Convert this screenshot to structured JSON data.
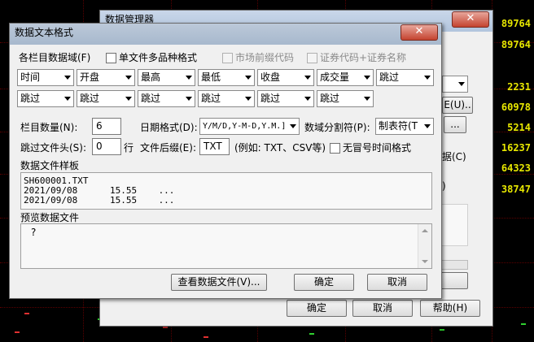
{
  "background": {
    "prices": [
      "89764",
      "89764",
      "2231",
      "60978",
      "5214",
      "16237",
      "64323",
      "38747"
    ]
  },
  "manager_dialog": {
    "title": "数据管理器",
    "right_label_1": "据(C)",
    "right_label_2": ")",
    "ok": "确定",
    "cancel": "取消",
    "help": "帮助(H)",
    "side_btn_1": "E(U)..",
    "side_btn_2": "..."
  },
  "format_dialog": {
    "title": "数据文本格式",
    "field_label": "各栏目数据域(F)",
    "multi_option_label": "单文件多品种格式",
    "market_prefix_label": "市场前缀代码",
    "code_name_label": "证券代码+证券名称",
    "fields_row1": [
      "时间",
      "开盘",
      "最高",
      "最低",
      "收盘",
      "成交量",
      "跳过"
    ],
    "fields_row2": [
      "跳过",
      "跳过",
      "跳过",
      "跳过",
      "跳过",
      "跳过"
    ],
    "column_count_label": "栏目数量(N):",
    "column_count_value": "6",
    "date_format_label": "日期格式(D):",
    "date_format_value": "Y/M/D,Y-M-D,Y.M.]",
    "separator_label": "数域分割符(P):",
    "separator_value": "制表符(T",
    "skip_header_label": "跳过文件头(S):",
    "skip_header_value": "0",
    "skip_header_unit": "行",
    "suffix_label": "文件后缀(E):",
    "suffix_value": "TXT",
    "suffix_example": "(例如: TXT、CSV等)",
    "no_colon_time_label": "无冒号时间格式",
    "sample_label": "数据文件样板",
    "sample_lines": [
      "SH600001.TXT",
      "2021/09/08      15.55    ...",
      "2021/09/08      15.55    ..."
    ],
    "preview_label": "预览数据文件",
    "preview_text": "?",
    "view_file_btn": "查看数据文件(V)...",
    "ok": "确定",
    "cancel": "取消"
  }
}
